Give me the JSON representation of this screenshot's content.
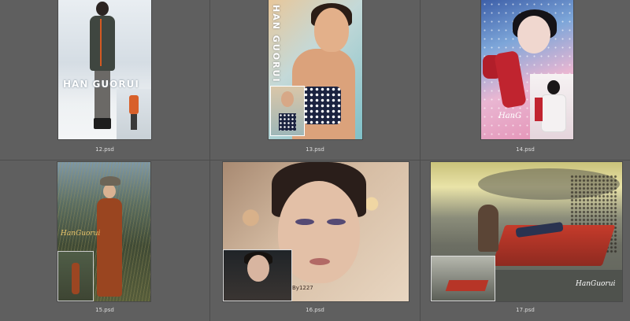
{
  "items": [
    {
      "filename": "12.psd",
      "overlay_text": "HAN GUORUI"
    },
    {
      "filename": "13.psd",
      "overlay_text": "HAN GUORUI"
    },
    {
      "filename": "14.psd",
      "overlay_text": "HanG"
    },
    {
      "filename": "15.psd",
      "overlay_text": "HanGuorui"
    },
    {
      "filename": "16.psd",
      "overlay_text": "By1227"
    },
    {
      "filename": "17.psd",
      "overlay_text": "HanGuorui"
    }
  ],
  "colors": {
    "background": "#5f5f5f",
    "caption_text": "#dcdcdc",
    "separator": "#4c4c4c"
  }
}
